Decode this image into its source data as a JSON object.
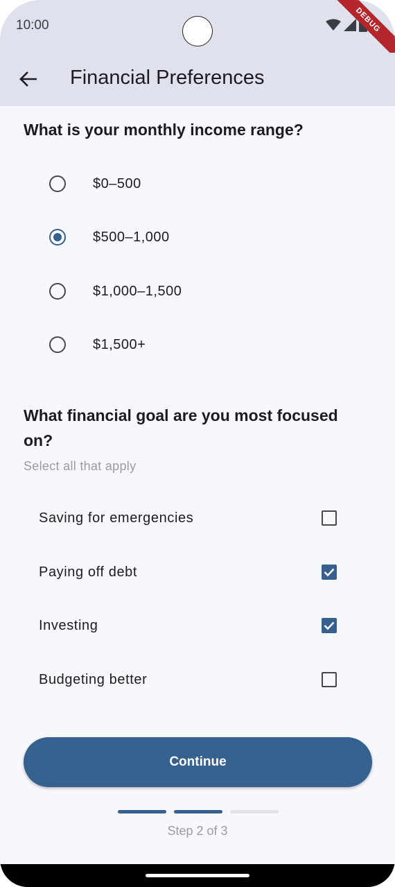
{
  "status_bar": {
    "time": "10:00",
    "debug_label": "DEBUG"
  },
  "app_bar": {
    "title": "Financial Preferences",
    "back_icon": "arrow-left-icon"
  },
  "income": {
    "question": "What is your monthly income range?",
    "options": [
      "$0–500",
      "$500–1,000",
      "$1,000–1,500",
      "$1,500+"
    ],
    "selected_index": 1
  },
  "goals": {
    "question": "What financial goal are you most focused on?",
    "hint": "Select all that apply",
    "options": [
      {
        "label": "Saving for emergencies",
        "checked": false
      },
      {
        "label": "Paying off debt",
        "checked": true
      },
      {
        "label": "Investing",
        "checked": true
      },
      {
        "label": "Budgeting better",
        "checked": false
      }
    ]
  },
  "continue_label": "Continue",
  "progress": {
    "text": "Step 2 of 3",
    "current": 2,
    "total": 3
  },
  "colors": {
    "accent": "#36618e",
    "app_bar_bg": "#dfe2ec",
    "page_bg": "#f7f8fd",
    "debug": "#b3262c"
  }
}
